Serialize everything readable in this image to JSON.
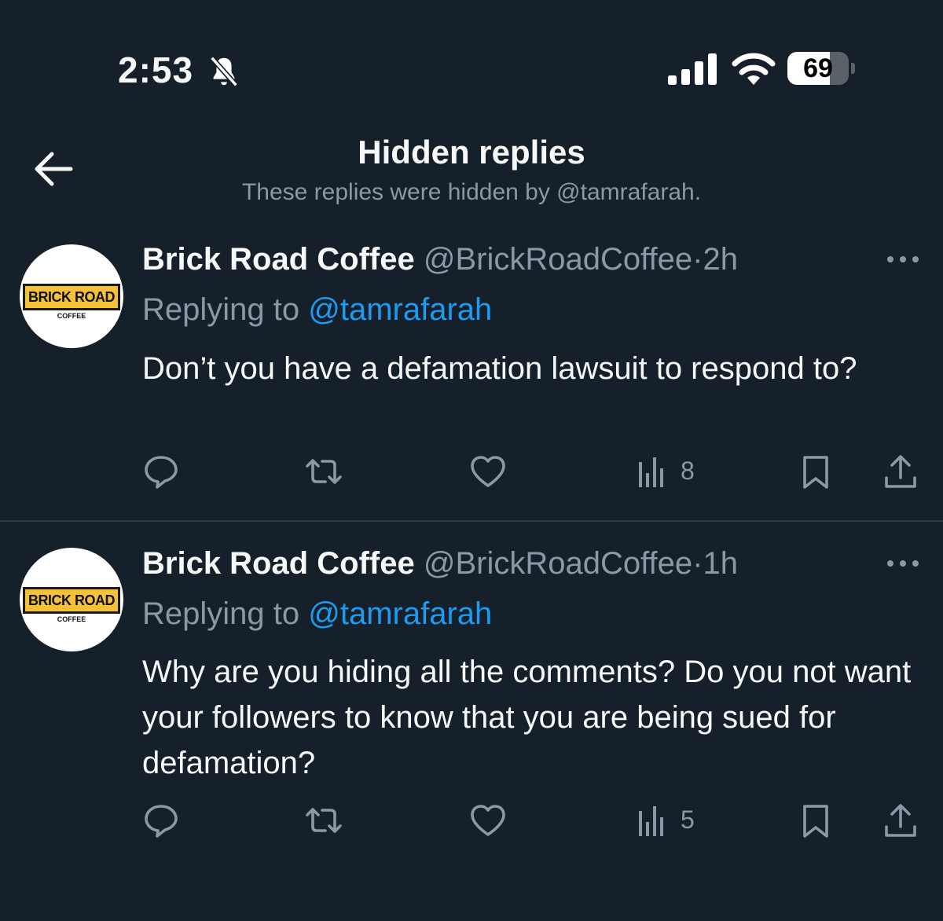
{
  "status_bar": {
    "time": "2:53",
    "battery": "69",
    "battery_level": 0.69,
    "icons": [
      "bell-slash-icon",
      "cellular-signal-icon",
      "wifi-icon",
      "battery-icon"
    ]
  },
  "header": {
    "title": "Hidden replies",
    "subtitle": "These replies were hidden by @tamrafarah.",
    "back_icon": "arrow-left-icon"
  },
  "tweets": [
    {
      "name": "Brick Road Coffee",
      "handle": "@BrickRoadCoffee",
      "separator": "·",
      "time": "2h",
      "replying_prefix": "Replying to",
      "replying_to": "@tamrafarah",
      "text": "Don’t you have a defamation lawsuit to respond to?",
      "views": "8",
      "avatar_logo_text": "BRICK ROAD",
      "avatar_logo_sub": "COFFEE"
    },
    {
      "name": "Brick Road Coffee",
      "handle": "@BrickRoadCoffee",
      "separator": "·",
      "time": "1h",
      "replying_prefix": "Replying to",
      "replying_to": "@tamrafarah",
      "text": "Why are you hiding all the comments? Do you not want your followers to know that you are being sued for defamation?",
      "views": "5",
      "avatar_logo_text": "BRICK ROAD",
      "avatar_logo_sub": "COFFEE"
    }
  ],
  "colors": {
    "background": "#15202b",
    "text": "#f7f9f9",
    "secondary": "#8b98a5",
    "link": "#1d9bf0"
  }
}
